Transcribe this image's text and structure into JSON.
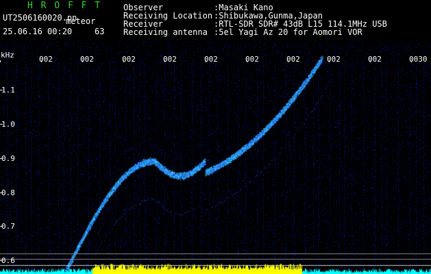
{
  "brand": {
    "title": "H R O F F T",
    "color": "#35d435"
  },
  "file": {
    "name": "UT2506160020.pn",
    "datetime": "25.06.16 00:20",
    "mode": "meteor",
    "value": "63"
  },
  "info": {
    "labels": [
      "Observer",
      "Receiving Location",
      "Receiver",
      "Receiving antenna"
    ],
    "values": [
      ":Masaki Kano",
      ":Shibukawa,Gunma,Japan",
      ":RTL-SDR SDR# 43dB L15 114.1MHz USB",
      ":5el Yagi Az 20 for Aomori VOR"
    ]
  },
  "axis": {
    "unit": "kHz",
    "ticks": [
      "1.1",
      "1.0",
      "0.9",
      "0.8",
      "0.7",
      "0.6"
    ],
    "time_labels": [
      "002",
      "002",
      "002",
      "002",
      "002",
      "002",
      "002",
      "002",
      "002",
      "0030"
    ]
  },
  "colors": {
    "background": "#000000",
    "noise": "#0a1aa0",
    "echo": "#3fe0ff",
    "signal_bar": "#ffff00",
    "baseline": "#00ffff"
  }
}
